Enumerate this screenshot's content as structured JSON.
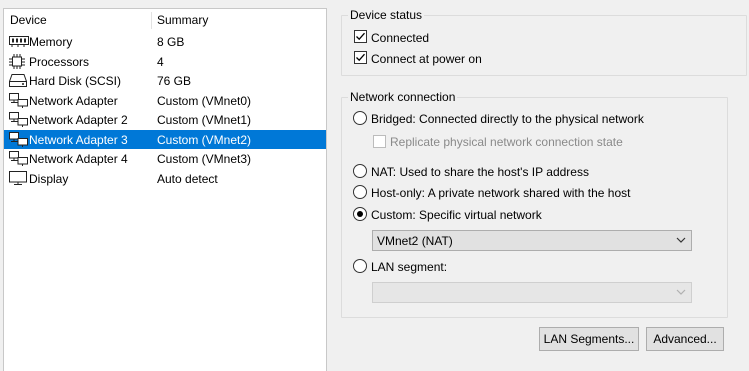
{
  "device_list": {
    "columns": {
      "device": "Device",
      "summary": "Summary"
    },
    "rows": [
      {
        "name": "Memory",
        "summary": "8 GB",
        "icon": "memory-icon"
      },
      {
        "name": "Processors",
        "summary": "4",
        "icon": "processor-icon"
      },
      {
        "name": "Hard Disk (SCSI)",
        "summary": "76 GB",
        "icon": "hard-disk-icon"
      },
      {
        "name": "Network Adapter",
        "summary": "Custom (VMnet0)",
        "icon": "network-adapter-icon"
      },
      {
        "name": "Network Adapter 2",
        "summary": "Custom (VMnet1)",
        "icon": "network-adapter-icon"
      },
      {
        "name": "Network Adapter 3",
        "summary": "Custom (VMnet2)",
        "icon": "network-adapter-icon",
        "selected": true
      },
      {
        "name": "Network Adapter 4",
        "summary": "Custom (VMnet3)",
        "icon": "network-adapter-icon"
      },
      {
        "name": "Display",
        "summary": "Auto detect",
        "icon": "display-icon"
      }
    ]
  },
  "device_status": {
    "title": "Device status",
    "connected": {
      "label": "Connected",
      "checked": true
    },
    "connect_at_power_on": {
      "label": "Connect at power on",
      "checked": true
    }
  },
  "network_connection": {
    "title": "Network connection",
    "bridged": {
      "label": "Bridged: Connected directly to the physical network",
      "selected": false
    },
    "replicate": {
      "label": "Replicate physical network connection state",
      "checked": false,
      "enabled": false
    },
    "nat": {
      "label": "NAT: Used to share the host's IP address",
      "selected": false
    },
    "host_only": {
      "label": "Host-only: A private network shared with the host",
      "selected": false
    },
    "custom": {
      "label": "Custom: Specific virtual network",
      "selected": true
    },
    "custom_network": {
      "value": "VMnet2 (NAT)"
    },
    "lan_segment": {
      "label": "LAN segment:",
      "selected": false
    },
    "lan_segment_value": {
      "value": "",
      "enabled": false
    }
  },
  "buttons": {
    "lan_segments": "LAN Segments...",
    "advanced": "Advanced..."
  },
  "colors": {
    "selection": "#0078d7",
    "window_bg": "#f0f0f0",
    "list_bg": "#ffffff"
  }
}
